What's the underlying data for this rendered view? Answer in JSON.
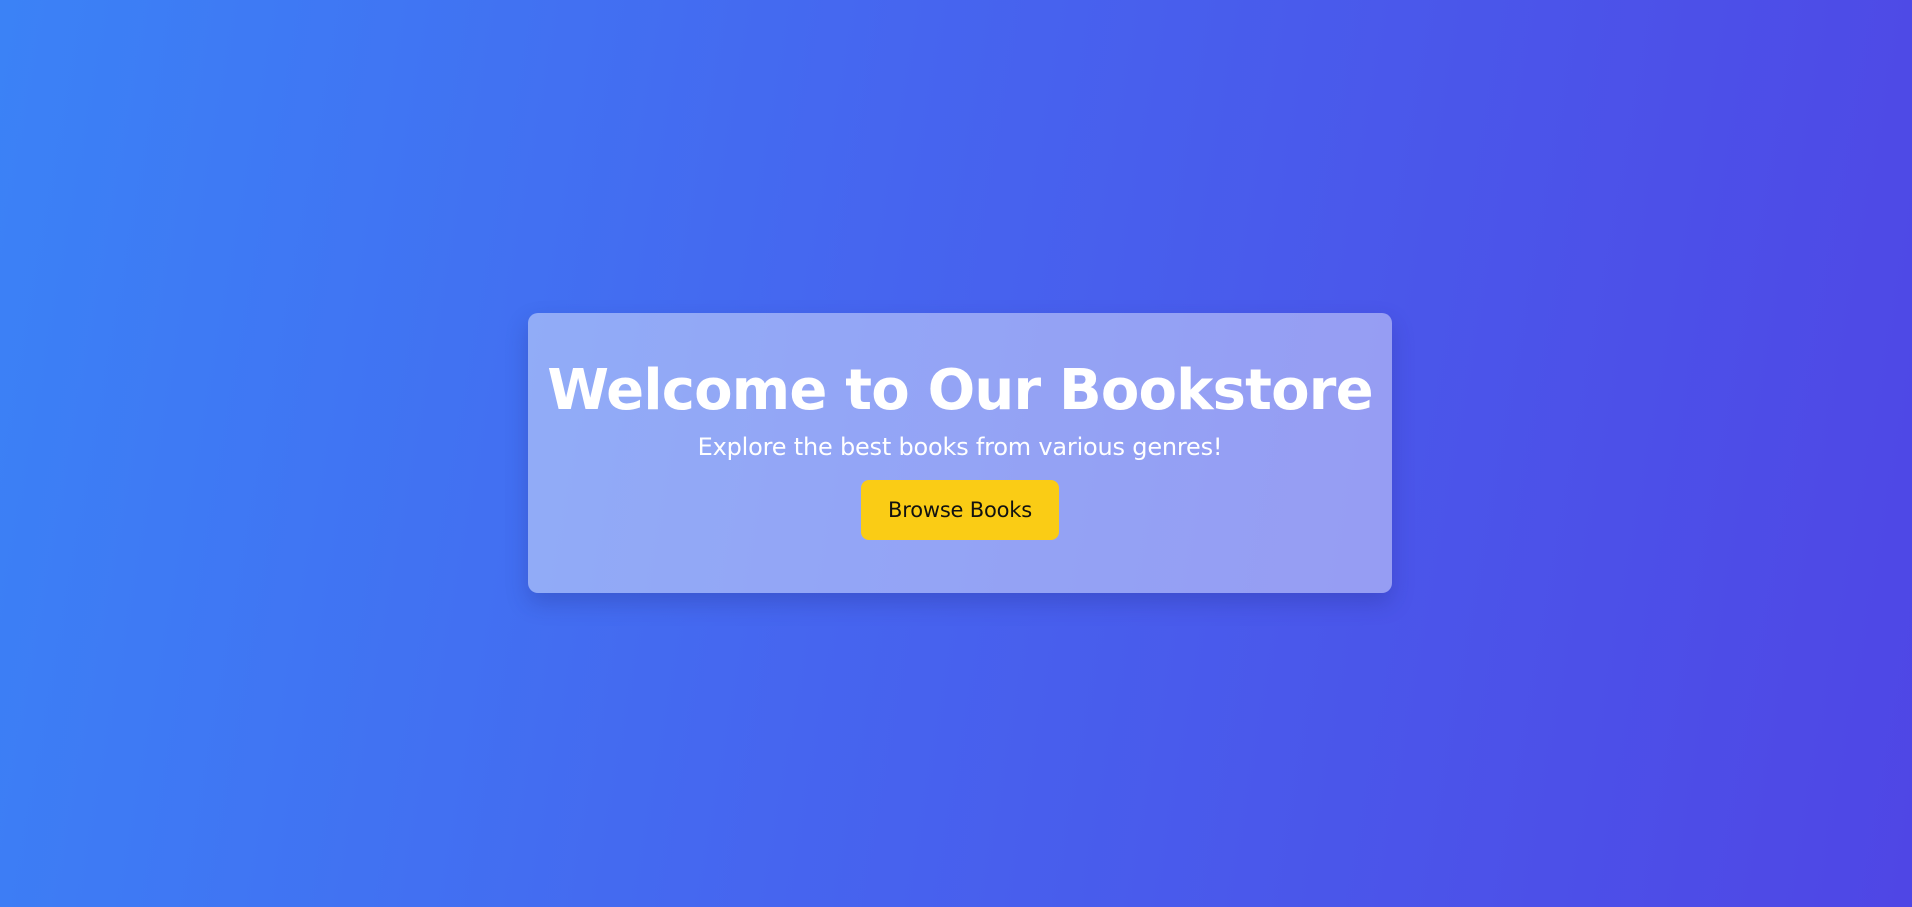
{
  "hero": {
    "title": "Welcome to Our Bookstore",
    "subtitle": "Explore the best books from various genres!",
    "button_label": "Browse Books"
  },
  "colors": {
    "background_start": "#3b82f6",
    "background_end": "#4f46e5",
    "button": "#facc15",
    "text": "#ffffff"
  }
}
